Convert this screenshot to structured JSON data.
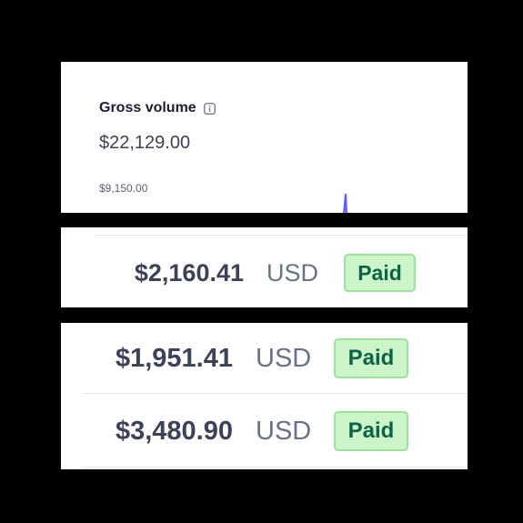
{
  "gross_volume": {
    "title": "Gross volume",
    "amount": "$22,129.00",
    "axis_max_label": "$9,150.00",
    "info_icon": "info-icon",
    "chart_color": "#635bff"
  },
  "payments": [
    {
      "amount": "$2,160.41",
      "currency": "USD",
      "status": "Paid"
    },
    {
      "amount": "$1,951.41",
      "currency": "USD",
      "status": "Paid"
    },
    {
      "amount": "$3,480.90",
      "currency": "USD",
      "status": "Paid"
    }
  ],
  "colors": {
    "background": "#000000",
    "paid_badge_bg": "#cbf4c9",
    "paid_badge_border": "#9be29a",
    "paid_badge_text": "#0e6245"
  }
}
